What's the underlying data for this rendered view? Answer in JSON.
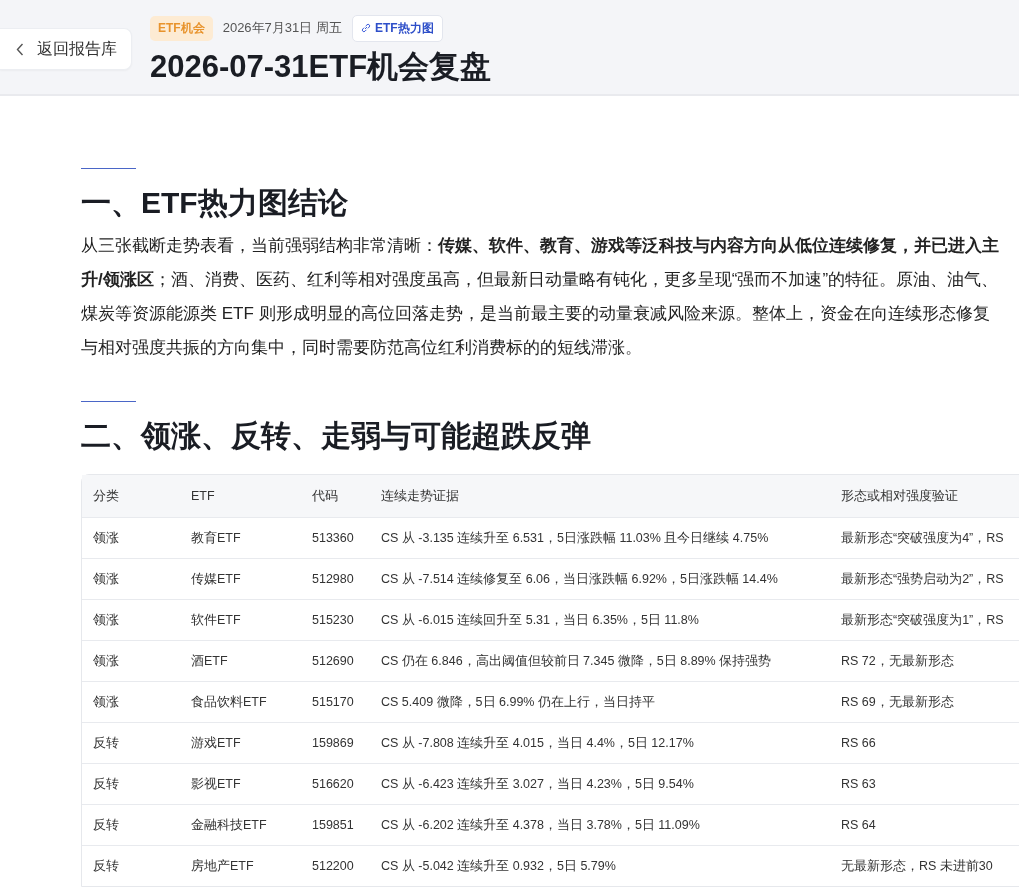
{
  "back_button": {
    "label": "返回报告库"
  },
  "header": {
    "tag": "ETF机会",
    "date": "2026年7月31日 周五",
    "link": {
      "label": "ETF热力图"
    },
    "title": "2026-07-31ETF机会复盘"
  },
  "sections": [
    {
      "heading": "一、ETF热力图结论",
      "paragraph": "从三张截断走势表看，当前强弱结构非常清晰：**传媒、软件、教育、游戏等泛科技与内容方向从低位连续修复，并已进入主升/领涨区**；酒、消费、医药、红利等相对强度虽高，但最新日动量略有钝化，更多呈现“强而不加速”的特征。原油、油气、煤炭等资源能源类 ETF 则形成明显的高位回落走势，是当前最主要的动量衰减风险来源。整体上，资金在向连续形态修复与相对强度共振的方向集中，同时需要防范高位红利消费标的的短线滞涨。"
    },
    {
      "heading": "二、领涨、反转、走弱与可能超跌反弹",
      "table": {
        "columns": [
          "分类",
          "ETF",
          "代码",
          "连续走势证据",
          "形态或相对强度验证"
        ],
        "rows": [
          [
            "领涨",
            "教育ETF",
            "513360",
            "CS 从 -3.135 连续升至 6.531，5日涨跌幅 11.03% 且今日继续 4.75%",
            "最新形态“突破强度为4”，RS"
          ],
          [
            "领涨",
            "传媒ETF",
            "512980",
            "CS 从 -7.514 连续修复至 6.06，当日涨跌幅 6.92%，5日涨跌幅 14.4%",
            "最新形态“强势启动为2”，RS"
          ],
          [
            "领涨",
            "软件ETF",
            "515230",
            "CS 从 -6.015 连续回升至 5.31，当日 6.35%，5日 11.8%",
            "最新形态“突破强度为1”，RS"
          ],
          [
            "领涨",
            "酒ETF",
            "512690",
            "CS 仍在 6.846，高出阈值但较前日 7.345 微降，5日 8.89% 保持强势",
            "RS 72，无最新形态"
          ],
          [
            "领涨",
            "食品饮料ETF",
            "515170",
            "CS 5.409 微降，5日 6.99% 仍在上行，当日持平",
            "RS 69，无最新形态"
          ],
          [
            "反转",
            "游戏ETF",
            "159869",
            "CS 从 -7.808 连续升至 4.015，当日 4.4%，5日 12.17%",
            "RS 66"
          ],
          [
            "反转",
            "影视ETF",
            "516620",
            "CS 从 -6.423 连续升至 3.027，当日 4.23%，5日 9.54%",
            "RS 63"
          ],
          [
            "反转",
            "金融科技ETF",
            "159851",
            "CS 从 -6.202 连续升至 4.378，当日 3.78%，5日 11.09%",
            "RS 64"
          ],
          [
            "反转",
            "房地产ETF",
            "512200",
            "CS 从 -5.042 连续升至 0.932，5日 5.79%",
            "无最新形态，RS 未进前30"
          ]
        ]
      }
    }
  ]
}
